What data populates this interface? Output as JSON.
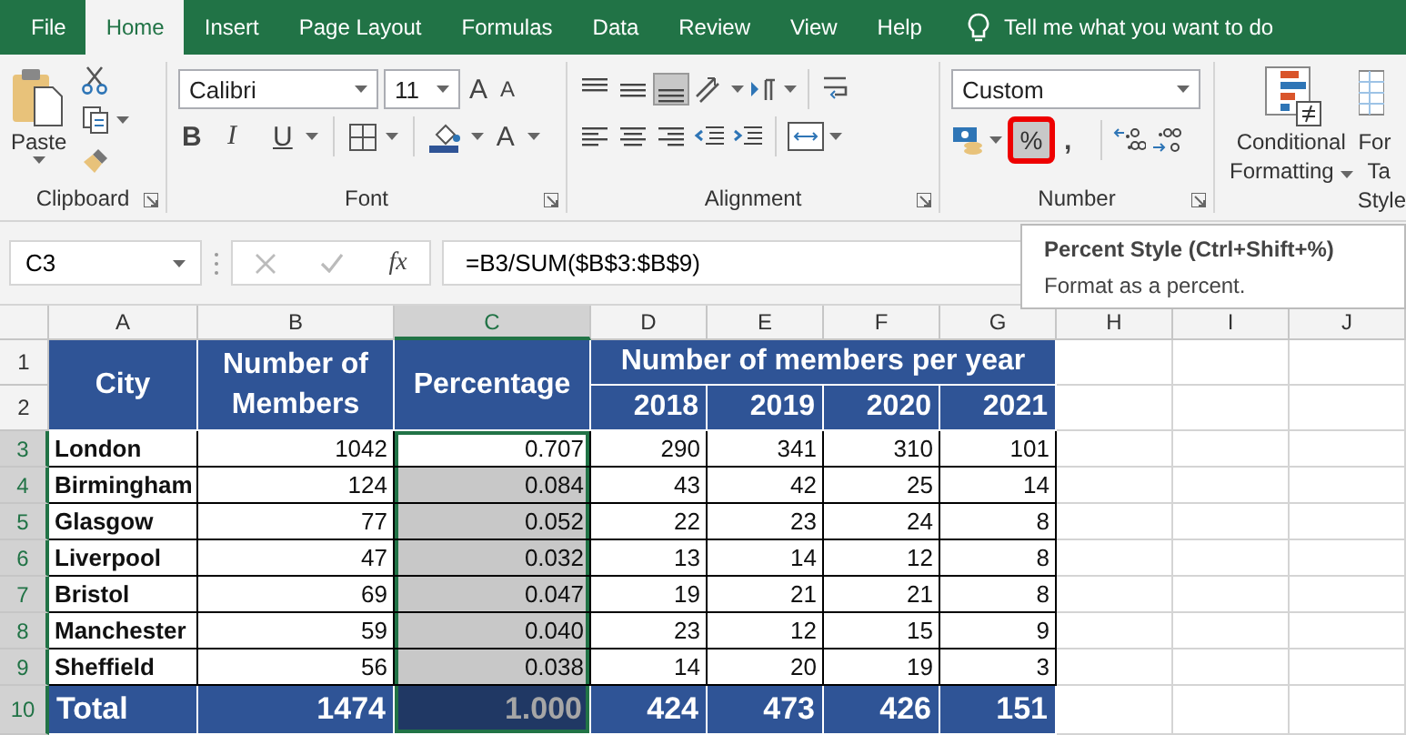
{
  "ribbon_tabs": [
    {
      "label": "File",
      "selected": false
    },
    {
      "label": "Home",
      "selected": true
    },
    {
      "label": "Insert",
      "selected": false
    },
    {
      "label": "Page Layout",
      "selected": false
    },
    {
      "label": "Formulas",
      "selected": false
    },
    {
      "label": "Data",
      "selected": false
    },
    {
      "label": "Review",
      "selected": false
    },
    {
      "label": "View",
      "selected": false
    },
    {
      "label": "Help",
      "selected": false
    }
  ],
  "tell_me": {
    "text": "Tell me what you want to do"
  },
  "clipboard": {
    "label": "Clipboard",
    "paste": "Paste"
  },
  "font": {
    "label": "Font",
    "font_name": "Calibri",
    "font_size": "11",
    "grow": "A",
    "shrink": "A",
    "bold": "B",
    "italic": "I",
    "underline": "U",
    "font_color": "A"
  },
  "alignment": {
    "label": "Alignment",
    "vertical": [
      {
        "kind": "top",
        "selected": false
      },
      {
        "kind": "middle",
        "selected": false
      },
      {
        "kind": "bottom",
        "selected": true
      }
    ]
  },
  "number": {
    "label": "Number",
    "format": "Custom",
    "percent": {
      "label": "%",
      "highlighted": true
    },
    "comma": ","
  },
  "styles": {
    "label": "Style",
    "conditional": [
      "Conditional",
      "Formatting"
    ],
    "format_table": [
      "For",
      "Ta"
    ]
  },
  "formula_bar": {
    "name_box": "C3",
    "function_label": "fx",
    "formula": "=B3/SUM($B$3:$B$9)"
  },
  "tooltip": {
    "title": "Percent Style (Ctrl+Shift+%)",
    "description": "Format as a percent."
  },
  "column_headers": [
    {
      "label": "A",
      "selected": false
    },
    {
      "label": "B",
      "selected": false
    },
    {
      "label": "C",
      "selected": true
    },
    {
      "label": "D",
      "selected": false
    },
    {
      "label": "E",
      "selected": false
    },
    {
      "label": "F",
      "selected": false
    },
    {
      "label": "G",
      "selected": false
    },
    {
      "label": "H",
      "selected": false
    },
    {
      "label": "I",
      "selected": false
    },
    {
      "label": "J",
      "selected": false
    }
  ],
  "row_headers": [
    {
      "label": "1",
      "selected": false
    },
    {
      "label": "2",
      "selected": false
    },
    {
      "label": "3",
      "selected": true
    },
    {
      "label": "4",
      "selected": true
    },
    {
      "label": "5",
      "selected": true
    },
    {
      "label": "6",
      "selected": true
    },
    {
      "label": "7",
      "selected": true
    },
    {
      "label": "8",
      "selected": true
    },
    {
      "label": "9",
      "selected": true
    },
    {
      "label": "10",
      "selected": true
    }
  ],
  "table": {
    "headers": {
      "city": "City",
      "members": "Number of Members",
      "percentage": "Percentage",
      "per_year": "Number of members per year",
      "years": [
        "2018",
        "2019",
        "2020",
        "2021"
      ]
    },
    "rows": [
      {
        "city": "London",
        "members": "1042",
        "percentage": "0.707",
        "highlight": false,
        "years": [
          "290",
          "341",
          "310",
          "101"
        ]
      },
      {
        "city": "Birmingham",
        "members": "124",
        "percentage": "0.084",
        "highlight": true,
        "years": [
          "43",
          "42",
          "25",
          "14"
        ]
      },
      {
        "city": "Glasgow",
        "members": "77",
        "percentage": "0.052",
        "highlight": true,
        "years": [
          "22",
          "23",
          "24",
          "8"
        ]
      },
      {
        "city": "Liverpool",
        "members": "47",
        "percentage": "0.032",
        "highlight": true,
        "years": [
          "13",
          "14",
          "12",
          "8"
        ]
      },
      {
        "city": "Bristol",
        "members": "69",
        "percentage": "0.047",
        "highlight": true,
        "years": [
          "19",
          "21",
          "21",
          "8"
        ]
      },
      {
        "city": "Manchester",
        "members": "59",
        "percentage": "0.040",
        "highlight": true,
        "years": [
          "23",
          "12",
          "15",
          "9"
        ]
      },
      {
        "city": "Sheffield",
        "members": "56",
        "percentage": "0.038",
        "highlight": true,
        "years": [
          "14",
          "20",
          "19",
          "3"
        ]
      }
    ],
    "total": {
      "city": "Total",
      "members": "1474",
      "percentage": "1.000",
      "highlight": true,
      "years": [
        "424",
        "473",
        "426",
        "151"
      ]
    }
  }
}
